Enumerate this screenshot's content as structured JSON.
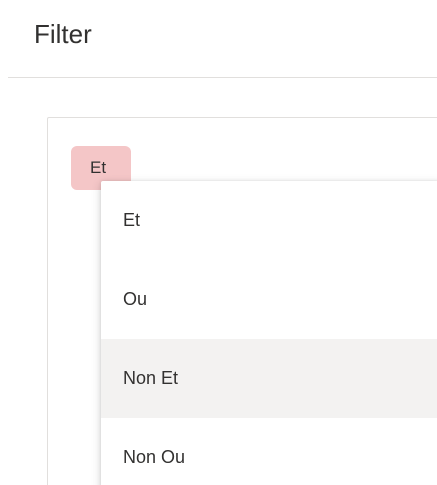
{
  "panel": {
    "title": "Filter"
  },
  "group": {
    "operator": "Et"
  },
  "operator_menu": {
    "options": [
      {
        "label": "Et"
      },
      {
        "label": "Ou"
      },
      {
        "label": "Non Et"
      },
      {
        "label": "Non Ou"
      }
    ],
    "highlighted_index": 2
  }
}
